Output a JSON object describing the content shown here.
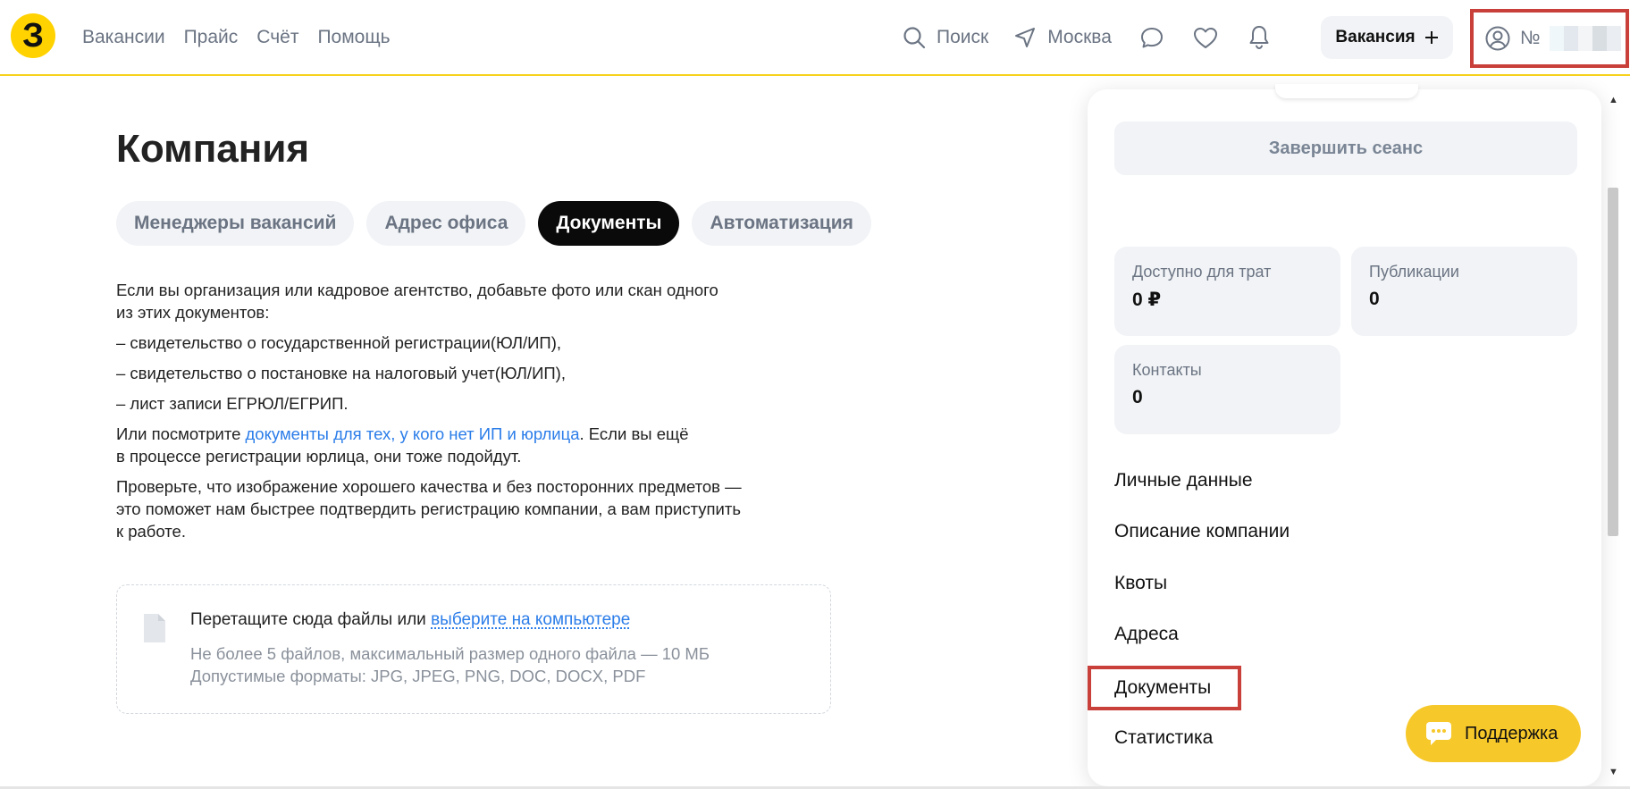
{
  "header": {
    "logo_text": "З",
    "nav": [
      "Вакансии",
      "Прайс",
      "Счёт",
      "Помощь"
    ],
    "search_label": "Поиск",
    "city_label": "Москва",
    "vacancy_button": "Вакансия",
    "profile_prefix": "№",
    "accent_color": "#ffd200"
  },
  "page": {
    "title": "Компания",
    "tabs": [
      {
        "label": "Менеджеры вакансий",
        "active": false
      },
      {
        "label": "Адрес офиса",
        "active": false
      },
      {
        "label": "Документы",
        "active": true
      },
      {
        "label": "Автоматизация",
        "active": false
      }
    ],
    "intro_line1": "Если вы организация или кадровое агентство, добавьте фото или скан одного",
    "intro_line2": "из этих документов:",
    "doc1": "– свидетельство о государственной регистрации(ЮЛ/ИП),",
    "doc2": "– свидетельство о постановке на налоговый учет(ЮЛ/ИП),",
    "doc3": "– лист записи ЕГРЮЛ/ЕГРИП.",
    "alt_prefix": "Или посмотрите ",
    "alt_link": "документы для тех, у кого нет ИП и юрлица",
    "alt_suffix": ". Если вы ещё",
    "alt_line2": "в процессе регистрации юрлица, они тоже подойдут.",
    "check_line1": "Проверьте, что изображение хорошего качества и без посторонних предметов —",
    "check_line2": "это поможет нам быстрее подтвердить регистрацию компании, а вам приступить",
    "check_line3": "к работе."
  },
  "upload": {
    "prefix": "Перетащите сюда файлы или ",
    "link": "выберите на компьютере",
    "limit": "Не более 5 файлов, максимальный размер одного файла — 10 МБ",
    "formats": "Допустимые форматы: JPG, JPEG, PNG, DOC, DOCX, PDF"
  },
  "dropdown": {
    "logout": "Завершить сеанс",
    "stats": [
      {
        "label": "Доступно для трат",
        "value": "0 ₽"
      },
      {
        "label": "Публикации",
        "value": "0"
      },
      {
        "label": "Контакты",
        "value": "0"
      }
    ],
    "menu": [
      "Личные данные",
      "Описание компании",
      "Квоты",
      "Адреса",
      "Документы",
      "Статистика"
    ]
  },
  "support_label": "Поддержка"
}
